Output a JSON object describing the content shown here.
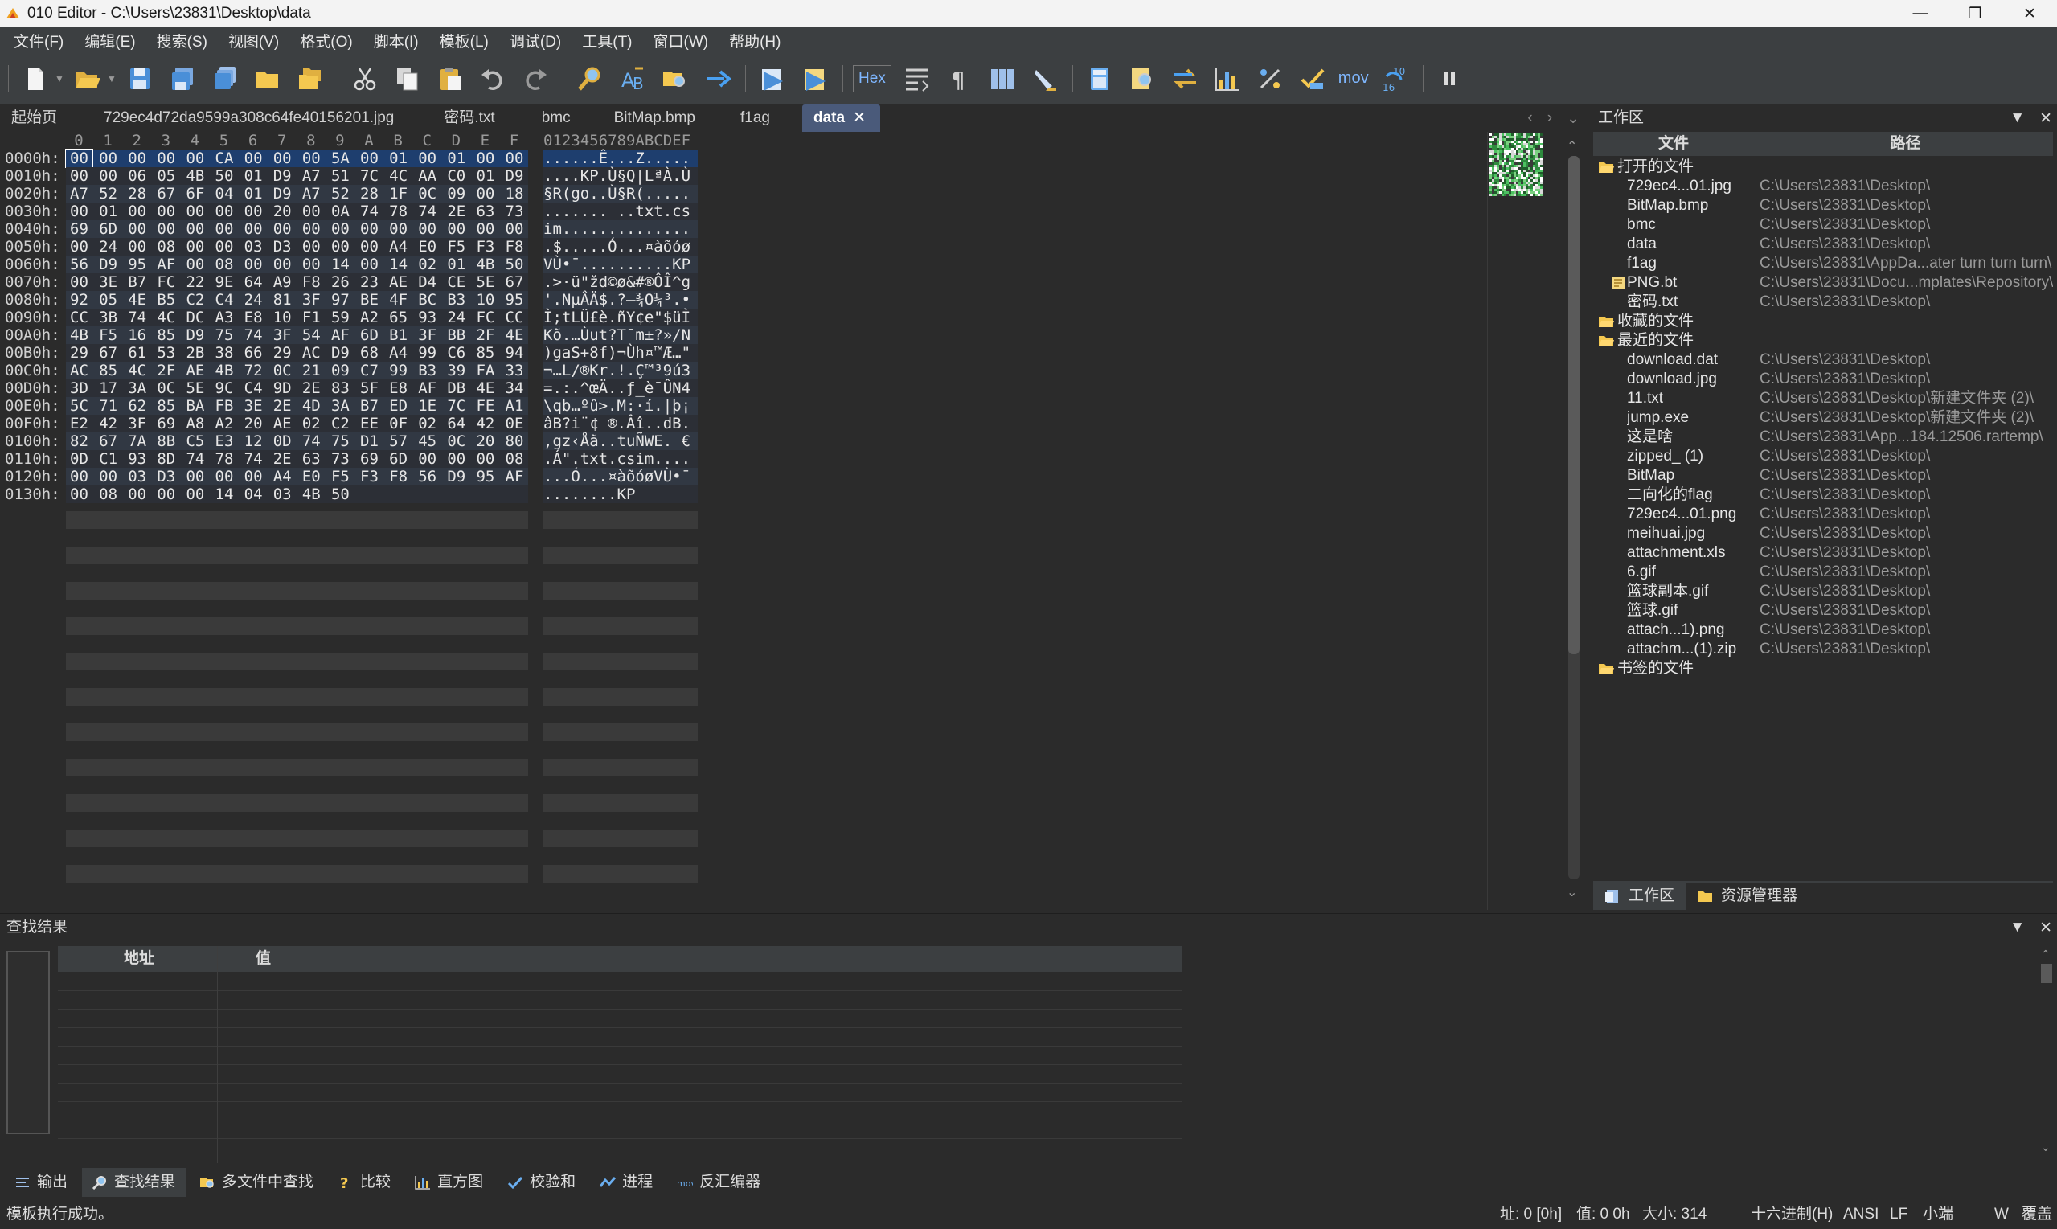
{
  "window": {
    "title": "010 Editor - C:\\Users\\23831\\Desktop\\data",
    "minimize": "—",
    "maximize": "❐",
    "close": "✕"
  },
  "menu": [
    "文件(F)",
    "编辑(E)",
    "搜索(S)",
    "视图(V)",
    "格式(O)",
    "脚本(I)",
    "模板(L)",
    "调试(D)",
    "工具(T)",
    "窗口(W)",
    "帮助(H)"
  ],
  "toolbar": {
    "hex_label": "Hex",
    "mov_label": "mov",
    "icons": [
      "new-file-icon",
      "open-folder-icon",
      "save-icon",
      "save-as-icon",
      "save-all-icon",
      "open-folder2-icon",
      "open-multiple-icon",
      "cut-icon",
      "copy-icon",
      "paste-icon",
      "undo-icon",
      "redo-icon",
      "find-icon",
      "replace-icon",
      "find-in-files-icon",
      "goto-icon",
      "run-script-icon",
      "run-template-icon",
      "hex-mode-icon",
      "text-wrap-icon",
      "paragraph-icon",
      "columns-icon",
      "highlight-icon",
      "calculator-icon",
      "inspector-icon",
      "compare-icon",
      "histogram-icon",
      "percent-icon",
      "checksum-icon",
      "disassembler-icon",
      "base-convert-icon",
      "pause-icon"
    ]
  },
  "tabs": [
    {
      "label": "起始页"
    },
    {
      "label": "729ec4d72da9599a308c64fe40156201.jpg"
    },
    {
      "label": "密码.txt"
    },
    {
      "label": "bmc"
    },
    {
      "label": "BitMap.bmp"
    },
    {
      "label": "f1ag"
    },
    {
      "label": "data",
      "active": true
    }
  ],
  "tab_close": "✕",
  "hex": {
    "column_header": [
      "0",
      "1",
      "2",
      "3",
      "4",
      "5",
      "6",
      "7",
      "8",
      "9",
      "A",
      "B",
      "C",
      "D",
      "E",
      "F"
    ],
    "ascii_header": "0123456789ABCDEF",
    "rows": [
      {
        "addr": "0000h:",
        "bytes": [
          "00",
          "00",
          "00",
          "00",
          "00",
          "CA",
          "00",
          "00",
          "00",
          "5A",
          "00",
          "01",
          "00",
          "01",
          "00",
          "00"
        ],
        "ascii": "......Ê...Z....."
      },
      {
        "addr": "0010h:",
        "bytes": [
          "00",
          "00",
          "06",
          "05",
          "4B",
          "50",
          "01",
          "D9",
          "A7",
          "51",
          "7C",
          "4C",
          "AA",
          "C0",
          "01",
          "D9"
        ],
        "ascii": "....KP.Ù§Q|LªÀ.Ù"
      },
      {
        "addr": "0020h:",
        "bytes": [
          "A7",
          "52",
          "28",
          "67",
          "6F",
          "04",
          "01",
          "D9",
          "A7",
          "52",
          "28",
          "1F",
          "0C",
          "09",
          "00",
          "18"
        ],
        "ascii": "§R(go..Ù§R(....."
      },
      {
        "addr": "0030h:",
        "bytes": [
          "00",
          "01",
          "00",
          "00",
          "00",
          "00",
          "00",
          "20",
          "00",
          "0A",
          "74",
          "78",
          "74",
          "2E",
          "63",
          "73"
        ],
        "ascii": "....... ..txt.cs"
      },
      {
        "addr": "0040h:",
        "bytes": [
          "69",
          "6D",
          "00",
          "00",
          "00",
          "00",
          "00",
          "00",
          "00",
          "00",
          "00",
          "00",
          "00",
          "00",
          "00",
          "00"
        ],
        "ascii": "im.............."
      },
      {
        "addr": "0050h:",
        "bytes": [
          "00",
          "24",
          "00",
          "08",
          "00",
          "00",
          "03",
          "D3",
          "00",
          "00",
          "00",
          "A4",
          "E0",
          "F5",
          "F3",
          "F8"
        ],
        "ascii": ".$.....Ó...¤àõóø"
      },
      {
        "addr": "0060h:",
        "bytes": [
          "56",
          "D9",
          "95",
          "AF",
          "00",
          "08",
          "00",
          "00",
          "00",
          "14",
          "00",
          "14",
          "02",
          "01",
          "4B",
          "50"
        ],
        "ascii": "VÙ•¯..........KP"
      },
      {
        "addr": "0070h:",
        "bytes": [
          "00",
          "3E",
          "B7",
          "FC",
          "22",
          "9E",
          "64",
          "A9",
          "F8",
          "26",
          "23",
          "AE",
          "D4",
          "CE",
          "5E",
          "67"
        ],
        "ascii": ".>·ü\"žd©ø&#®ÔÎ^g"
      },
      {
        "addr": "0080h:",
        "bytes": [
          "92",
          "05",
          "4E",
          "B5",
          "C2",
          "C4",
          "24",
          "81",
          "3F",
          "97",
          "BE",
          "4F",
          "BC",
          "B3",
          "10",
          "95"
        ],
        "ascii": "'.NµÂÄ$.?—¾O¼³.•"
      },
      {
        "addr": "0090h:",
        "bytes": [
          "CC",
          "3B",
          "74",
          "4C",
          "DC",
          "A3",
          "E8",
          "10",
          "F1",
          "59",
          "A2",
          "65",
          "93",
          "24",
          "FC",
          "CC"
        ],
        "ascii": "Ì;tLÜ£è.ñY¢e\"$üÌ"
      },
      {
        "addr": "00A0h:",
        "bytes": [
          "4B",
          "F5",
          "16",
          "85",
          "D9",
          "75",
          "74",
          "3F",
          "54",
          "AF",
          "6D",
          "B1",
          "3F",
          "BB",
          "2F",
          "4E"
        ],
        "ascii": "Kõ.…Ùut?T¯m±?»/N"
      },
      {
        "addr": "00B0h:",
        "bytes": [
          "29",
          "67",
          "61",
          "53",
          "2B",
          "38",
          "66",
          "29",
          "AC",
          "D9",
          "68",
          "A4",
          "99",
          "C6",
          "85",
          "94"
        ],
        "ascii": ")gaS+8f)¬Ùh¤™Æ…\""
      },
      {
        "addr": "00C0h:",
        "bytes": [
          "AC",
          "85",
          "4C",
          "2F",
          "AE",
          "4B",
          "72",
          "0C",
          "21",
          "09",
          "C7",
          "99",
          "B3",
          "39",
          "FA",
          "33"
        ],
        "ascii": "¬…L/®Kr.!.Ç™³9ú3"
      },
      {
        "addr": "00D0h:",
        "bytes": [
          "3D",
          "17",
          "3A",
          "0C",
          "5E",
          "9C",
          "C4",
          "9D",
          "2E",
          "83",
          "5F",
          "E8",
          "AF",
          "DB",
          "4E",
          "34"
        ],
        "ascii": "=.:.^œÄ..ƒ_è¯ÛN4"
      },
      {
        "addr": "00E0h:",
        "bytes": [
          "5C",
          "71",
          "62",
          "85",
          "BA",
          "FB",
          "3E",
          "2E",
          "4D",
          "3A",
          "B7",
          "ED",
          "1E",
          "7C",
          "FE",
          "A1"
        ],
        "ascii": "\\qb…ºû>.M:·í.|þ¡"
      },
      {
        "addr": "00F0h:",
        "bytes": [
          "E2",
          "42",
          "3F",
          "69",
          "A8",
          "A2",
          "20",
          "AE",
          "02",
          "C2",
          "EE",
          "0F",
          "02",
          "64",
          "42",
          "0E"
        ],
        "ascii": "âB?i¨¢ ®.Âî..dB."
      },
      {
        "addr": "0100h:",
        "bytes": [
          "82",
          "67",
          "7A",
          "8B",
          "C5",
          "E3",
          "12",
          "0D",
          "74",
          "75",
          "D1",
          "57",
          "45",
          "0C",
          "20",
          "80"
        ],
        "ascii": ",gz‹Åã..tuÑWE. €"
      },
      {
        "addr": "0110h:",
        "bytes": [
          "0D",
          "C1",
          "93",
          "8D",
          "74",
          "78",
          "74",
          "2E",
          "63",
          "73",
          "69",
          "6D",
          "00",
          "00",
          "00",
          "08"
        ],
        "ascii": ".Á\".txt.csim...."
      },
      {
        "addr": "0120h:",
        "bytes": [
          "00",
          "00",
          "03",
          "D3",
          "00",
          "00",
          "00",
          "A4",
          "E0",
          "F5",
          "F3",
          "F8",
          "56",
          "D9",
          "95",
          "AF"
        ],
        "ascii": "...Ó...¤àõóøVÙ•¯"
      },
      {
        "addr": "0130h:",
        "bytes": [
          "00",
          "08",
          "00",
          "00",
          "00",
          "14",
          "04",
          "03",
          "4B",
          "50"
        ],
        "ascii": "........KP"
      }
    ]
  },
  "workspace": {
    "title": "工作区",
    "col_file": "文件",
    "col_path": "路径",
    "groups": [
      {
        "label": "打开的文件",
        "items": [
          {
            "name": "729ec4...01.jpg",
            "path": "C:\\Users\\23831\\Desktop\\"
          },
          {
            "name": "BitMap.bmp",
            "path": "C:\\Users\\23831\\Desktop\\"
          },
          {
            "name": "bmc",
            "path": "C:\\Users\\23831\\Desktop\\"
          },
          {
            "name": "data",
            "path": "C:\\Users\\23831\\Desktop\\"
          },
          {
            "name": "f1ag",
            "path": "C:\\Users\\23831\\AppDa...ater turn turn turn\\"
          },
          {
            "name": "PNG.bt",
            "path": "C:\\Users\\23831\\Docu...mplates\\Repository\\"
          },
          {
            "name": "密码.txt",
            "path": "C:\\Users\\23831\\Desktop\\"
          }
        ]
      },
      {
        "label": "收藏的文件",
        "items": []
      },
      {
        "label": "最近的文件",
        "items": [
          {
            "name": "download.dat",
            "path": "C:\\Users\\23831\\Desktop\\"
          },
          {
            "name": "download.jpg",
            "path": "C:\\Users\\23831\\Desktop\\"
          },
          {
            "name": "11.txt",
            "path": "C:\\Users\\23831\\Desktop\\新建文件夹 (2)\\"
          },
          {
            "name": "jump.exe",
            "path": "C:\\Users\\23831\\Desktop\\新建文件夹 (2)\\"
          },
          {
            "name": "这是啥",
            "path": "C:\\Users\\23831\\App...184.12506.rartemp\\"
          },
          {
            "name": "zipped_ (1)",
            "path": "C:\\Users\\23831\\Desktop\\"
          },
          {
            "name": "BitMap",
            "path": "C:\\Users\\23831\\Desktop\\"
          },
          {
            "name": "二向化的flag",
            "path": "C:\\Users\\23831\\Desktop\\"
          },
          {
            "name": "729ec4...01.png",
            "path": "C:\\Users\\23831\\Desktop\\"
          },
          {
            "name": "meihuai.jpg",
            "path": "C:\\Users\\23831\\Desktop\\"
          },
          {
            "name": "attachment.xls",
            "path": "C:\\Users\\23831\\Desktop\\"
          },
          {
            "name": "6.gif",
            "path": "C:\\Users\\23831\\Desktop\\"
          },
          {
            "name": "篮球副本.gif",
            "path": "C:\\Users\\23831\\Desktop\\"
          },
          {
            "name": "篮球.gif",
            "path": "C:\\Users\\23831\\Desktop\\"
          },
          {
            "name": "attach...1).png",
            "path": "C:\\Users\\23831\\Desktop\\"
          },
          {
            "name": "attachm...(1).zip",
            "path": "C:\\Users\\23831\\Desktop\\"
          }
        ]
      },
      {
        "label": "书签的文件",
        "items": []
      }
    ],
    "bottom_tabs": [
      "工作区",
      "资源管理器"
    ]
  },
  "find": {
    "title": "查找结果",
    "col_addr": "地址",
    "col_value": "值"
  },
  "tooltabs": [
    "输出",
    "查找结果",
    "多文件中查找",
    "比较",
    "直方图",
    "校验和",
    "进程",
    "反汇编器"
  ],
  "status": {
    "message": "模板执行成功。",
    "address": "址: 0 [0h]",
    "value": "值: 0 0h",
    "size": "大小: 314",
    "mode": "十六进制(H)",
    "encoding": "ANSI",
    "line_ending": "LF",
    "endian": "小端",
    "w": "W",
    "overwrite": "覆盖"
  }
}
